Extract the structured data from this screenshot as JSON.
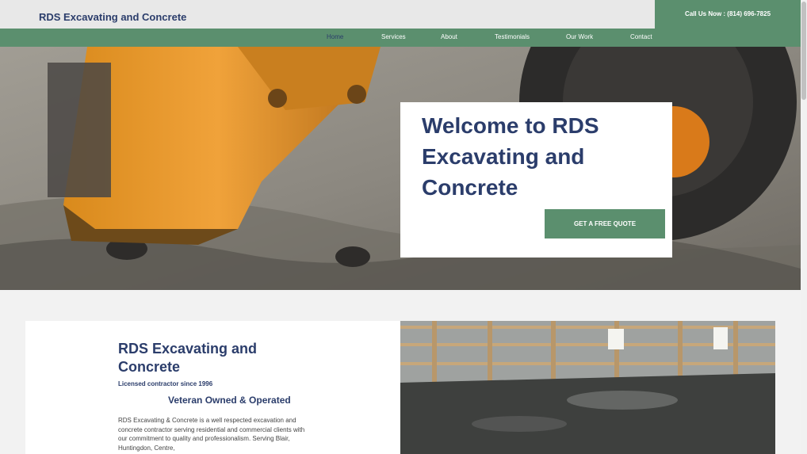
{
  "header": {
    "brand": "RDS Excavating and Concrete",
    "call_text": "Call Us Now : (814) 696-7825"
  },
  "nav": {
    "items": [
      {
        "label": "Home",
        "active": true
      },
      {
        "label": "Services"
      },
      {
        "label": "About"
      },
      {
        "label": "Testimonials"
      },
      {
        "label": "Our Work"
      },
      {
        "label": "Contact"
      }
    ]
  },
  "hero": {
    "title": "Welcome to RDS Excavating and Concrete",
    "cta_label": "GET A FREE QUOTE"
  },
  "about": {
    "title": "RDS Excavating and Concrete",
    "subtitle": "Licensed contractor since 1996",
    "veteran": "Veteran Owned & Operated",
    "body": "RDS Excavating & Concrete is a well respected excavation and concrete contractor serving residential and commercial clients with our commitment to quality and professionalism. Serving Blair, Huntingdon, Centre,"
  },
  "colors": {
    "accent_green": "#5b8f6e",
    "navy": "#2b3d6b"
  }
}
